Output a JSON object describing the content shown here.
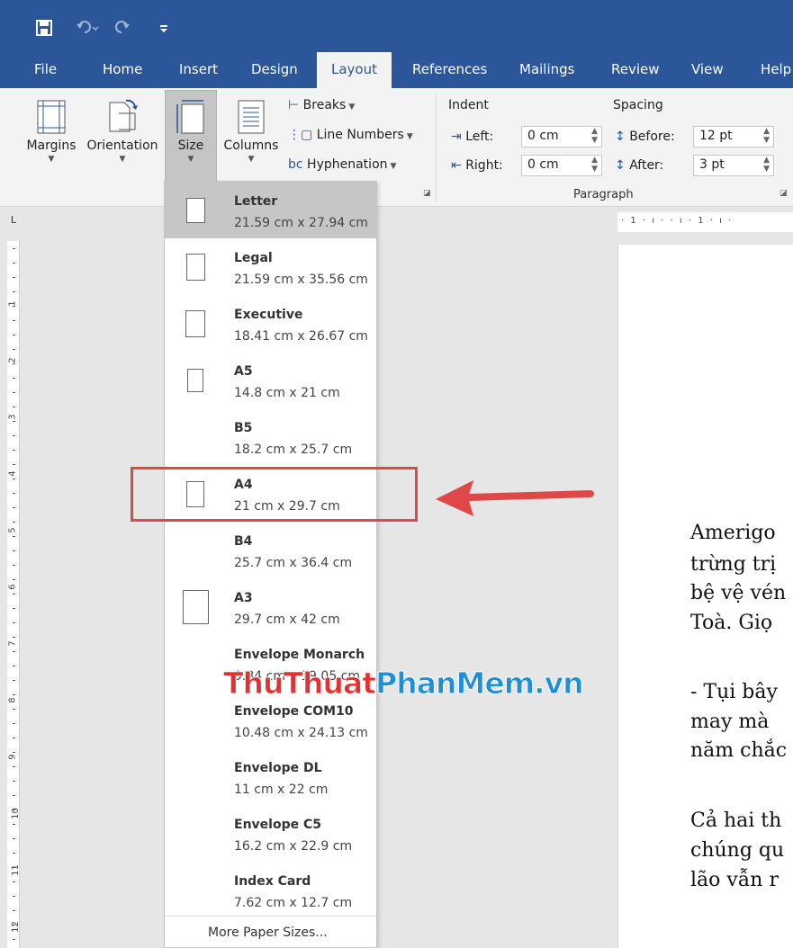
{
  "qat": {
    "save_icon": "save-icon",
    "undo_icon": "undo-icon",
    "redo_icon": "redo-icon",
    "customize_icon": "customize-icon"
  },
  "tabs": [
    "File",
    "Home",
    "Insert",
    "Design",
    "Layout",
    "References",
    "Mailings",
    "Review",
    "View",
    "Help"
  ],
  "ribbon": {
    "margins": "Margins",
    "orientation": "Orientation",
    "size": "Size",
    "columns": "Columns",
    "breaks": "Breaks",
    "line_numbers": "Line Numbers",
    "hyphenation": "Hyphenation",
    "indent": "Indent",
    "left_label": "Left:",
    "left_value": "0 cm",
    "right_label": "Right:",
    "right_value": "0 cm",
    "spacing": "Spacing",
    "before_label": "Before:",
    "before_value": "12 pt",
    "after_label": "After:",
    "after_value": "3 pt",
    "paragraph": "Paragraph"
  },
  "ruler": {
    "numbers": [
      "1",
      "2",
      "3",
      "4",
      "5",
      "6",
      "7",
      "8",
      "9",
      "10",
      "11",
      "12"
    ],
    "corner": "L",
    "horizontal": "· 1 · ı · · ı · 1 · ı ·"
  },
  "paper_sizes": [
    {
      "name": "Letter",
      "dims": "21.59 cm x 27.94 cm",
      "selected": true
    },
    {
      "name": "Legal",
      "dims": "21.59 cm x 35.56 cm"
    },
    {
      "name": "Executive",
      "dims": "18.41 cm x 26.67 cm"
    },
    {
      "name": "A5",
      "dims": "14.8 cm x 21 cm"
    },
    {
      "name": "B5",
      "dims": "18.2 cm x 25.7 cm"
    },
    {
      "name": "A4",
      "dims": "21 cm x 29.7 cm"
    },
    {
      "name": "B4",
      "dims": "25.7 cm x 36.4 cm"
    },
    {
      "name": "A3",
      "dims": "29.7 cm x 42 cm"
    },
    {
      "name": "Envelope Monarch",
      "dims": "9.84 cm x 19.05 cm"
    },
    {
      "name": "Envelope COM10",
      "dims": "10.48 cm x 24.13 cm"
    },
    {
      "name": "Envelope DL",
      "dims": "11 cm x 22 cm"
    },
    {
      "name": "Envelope C5",
      "dims": "16.2 cm x 22.9 cm"
    },
    {
      "name": "Index Card",
      "dims": "7.62 cm x 12.7 cm"
    }
  ],
  "more_sizes": "More Paper Sizes...",
  "document_lines": [
    "Amerigo",
    "trừng trị",
    "bệ vệ vén",
    "Toà. Giọ",
    "- Tụi bây",
    "may mà",
    "năm chắc",
    "Cả hai th",
    "chúng qu",
    "lão vẫn r"
  ],
  "watermark": {
    "part1": "ThuThuat",
    "part2": "PhanMem.vn"
  },
  "colors": {
    "ribbon_blue": "#2b579a",
    "highlight_red": "#e04848"
  }
}
